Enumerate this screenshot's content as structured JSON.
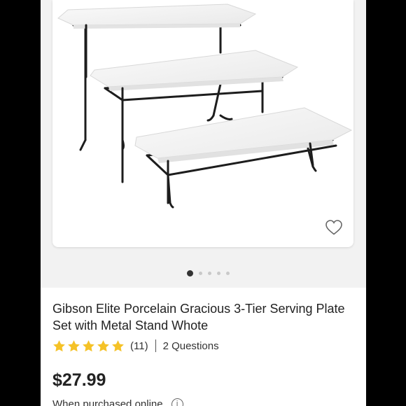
{
  "product": {
    "title": "Gibson Elite Porcelain Gracious 3-Tier Serving Plate Set with Metal Stand Whote",
    "rating_stars": 5,
    "review_count": "(11)",
    "questions_link": "2 Questions",
    "price": "$27.99",
    "purchase_note": "When purchased online"
  },
  "gallery": {
    "total_images": 5,
    "active_index": 0
  },
  "icons": {
    "favorite": "heart-outline-icon",
    "info": "info-circle-icon",
    "star": "star-icon"
  },
  "colors": {
    "star": "#f5c227",
    "background": "#f2f2f2",
    "frame": "#000000"
  }
}
